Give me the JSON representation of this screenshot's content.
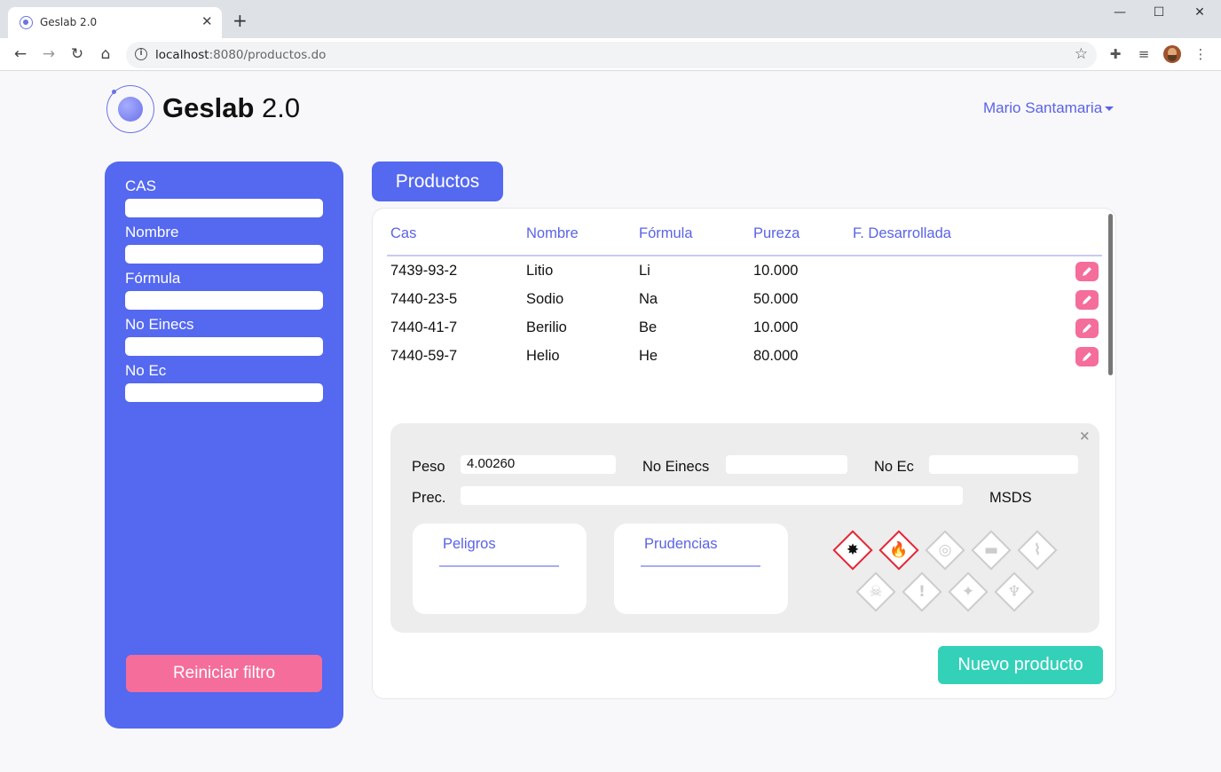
{
  "browser": {
    "tab_title": "Geslab 2.0",
    "url_host": "localhost",
    "url_rest": ":8080/productos.do"
  },
  "header": {
    "brand_bold": "Geslab",
    "brand_light": "2.0",
    "user_name": "Mario Santamaria"
  },
  "filters": {
    "fields": [
      {
        "label": "CAS",
        "value": ""
      },
      {
        "label": "Nombre",
        "value": ""
      },
      {
        "label": "Fórmula",
        "value": ""
      },
      {
        "label": "No Einecs",
        "value": ""
      },
      {
        "label": "No Ec",
        "value": ""
      }
    ],
    "reset_label": "Reiniciar filtro"
  },
  "products": {
    "tab_label": "Productos",
    "columns": [
      "Cas",
      "Nombre",
      "Fórmula",
      "Pureza",
      "F. Desarrollada"
    ],
    "rows": [
      {
        "cas": "7439-93-2",
        "nombre": "Litio",
        "formula": "Li",
        "pureza": "10.000",
        "desarrollada": ""
      },
      {
        "cas": "7440-23-5",
        "nombre": "Sodio",
        "formula": "Na",
        "pureza": "50.000",
        "desarrollada": ""
      },
      {
        "cas": "7440-41-7",
        "nombre": "Berilio",
        "formula": "Be",
        "pureza": "10.000",
        "desarrollada": ""
      },
      {
        "cas": "7440-59-7",
        "nombre": "Helio",
        "formula": "He",
        "pureza": "80.000",
        "desarrollada": ""
      }
    ],
    "new_label": "Nuevo producto"
  },
  "detail": {
    "close_label": "×",
    "peso_label": "Peso",
    "peso_value": "4.00260",
    "einecs_label": "No Einecs",
    "einecs_value": "",
    "ec_label": "No Ec",
    "ec_value": "",
    "prec_label": "Prec.",
    "prec_value": "",
    "msds_label": "MSDS",
    "peligros_label": "Peligros",
    "prudencias_label": "Prudencias",
    "pictograms": [
      {
        "name": "explosive-icon",
        "active": true
      },
      {
        "name": "flammable-icon",
        "active": true
      },
      {
        "name": "oxidizer-icon",
        "active": false
      },
      {
        "name": "gas-cylinder-icon",
        "active": false
      },
      {
        "name": "corrosive-icon",
        "active": false
      },
      {
        "name": "toxic-icon",
        "active": false
      },
      {
        "name": "exclamation-icon",
        "active": false
      },
      {
        "name": "health-hazard-icon",
        "active": false
      },
      {
        "name": "environment-icon",
        "active": false
      }
    ]
  },
  "colors": {
    "primary": "#5468f0",
    "accent_pink": "#f46d9b",
    "accent_teal": "#34d1b9",
    "ghs_red": "#e32636"
  }
}
